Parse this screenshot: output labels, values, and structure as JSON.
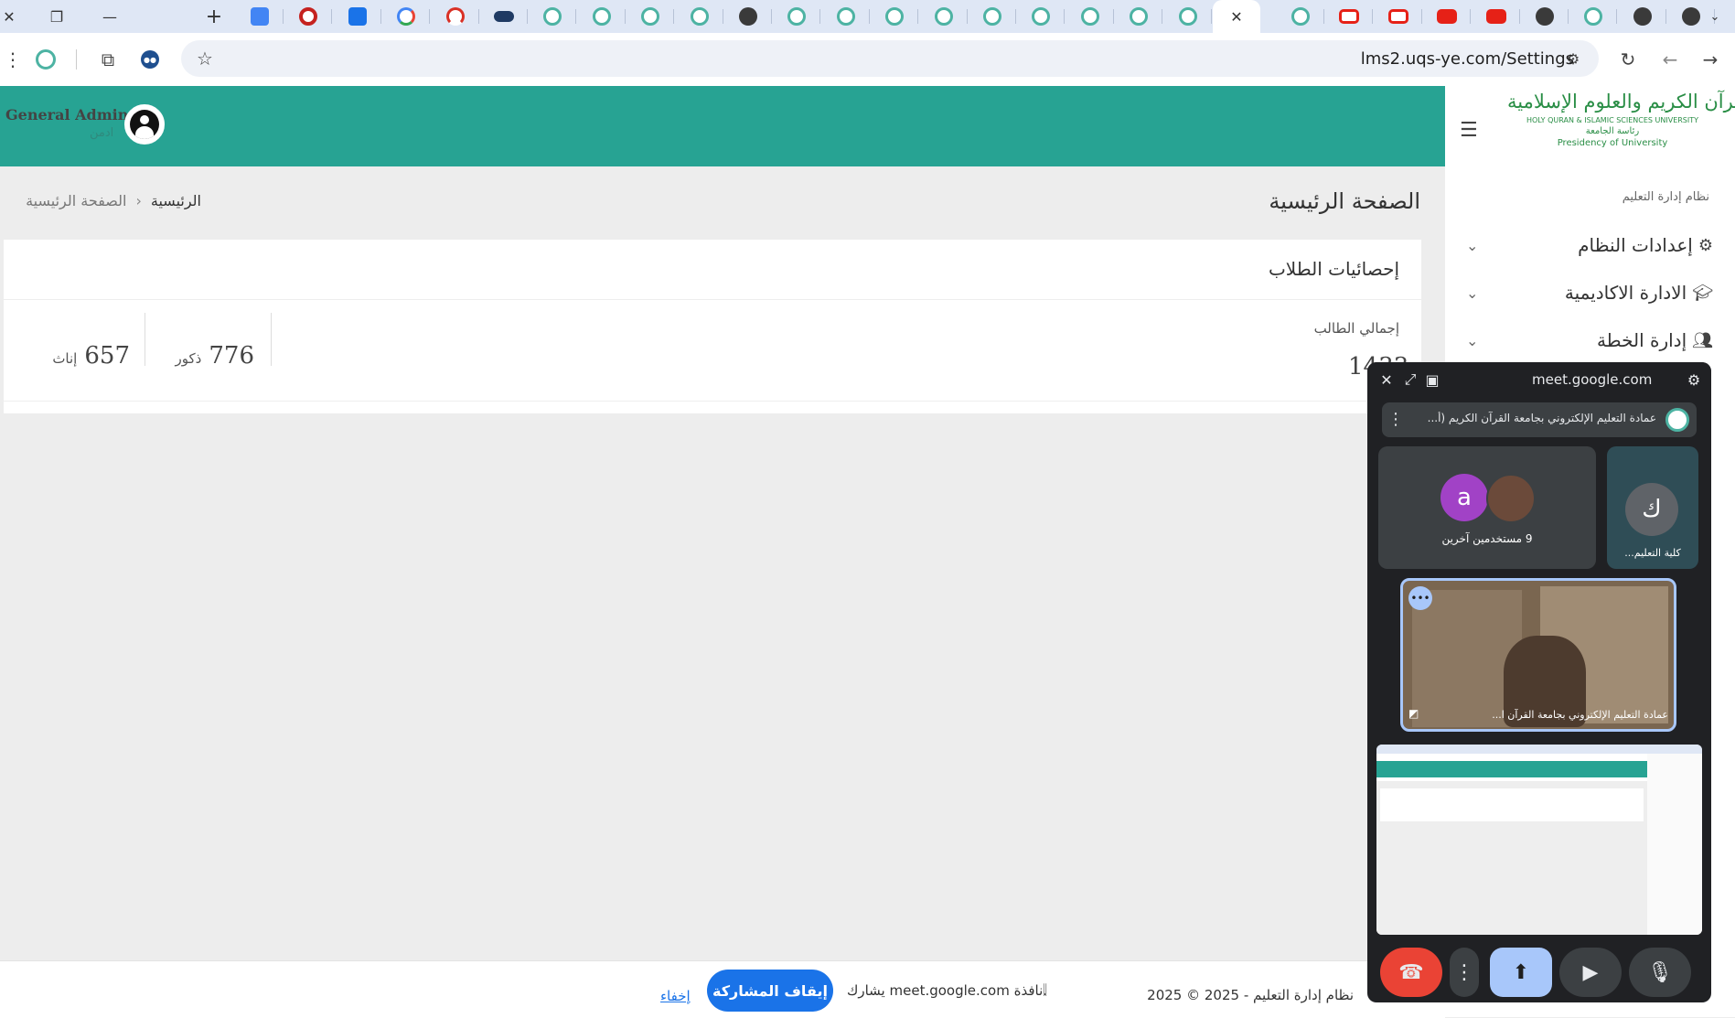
{
  "browser": {
    "url": "lms2.uqs-ye.com/Settings",
    "tabs": [
      {
        "icon": "translate-icon",
        "kind": "tr"
      },
      {
        "icon": "record-icon",
        "kind": "red"
      },
      {
        "icon": "download-icon",
        "kind": "blue"
      },
      {
        "icon": "google-icon",
        "kind": "goo"
      },
      {
        "icon": "gauge-icon",
        "kind": "gauge"
      },
      {
        "icon": "toggle-icon",
        "kind": "pill"
      },
      {
        "icon": "university-logo-icon",
        "kind": "uni"
      },
      {
        "icon": "university-logo-icon",
        "kind": "uni"
      },
      {
        "icon": "university-logo-icon",
        "kind": "uni"
      },
      {
        "icon": "university-logo-icon",
        "kind": "uni"
      },
      {
        "icon": "chrome-icon",
        "kind": "dark"
      },
      {
        "icon": "university-logo-icon",
        "kind": "uni"
      },
      {
        "icon": "university-logo-icon",
        "kind": "uni"
      },
      {
        "icon": "university-logo-icon",
        "kind": "uni"
      },
      {
        "icon": "university-logo-icon",
        "kind": "uni"
      },
      {
        "icon": "university-logo-icon",
        "kind": "uni"
      },
      {
        "icon": "university-logo-icon",
        "kind": "uni"
      },
      {
        "icon": "university-logo-icon",
        "kind": "uni"
      },
      {
        "icon": "university-logo-icon",
        "kind": "uni"
      },
      {
        "icon": "university-logo-icon",
        "kind": "uni"
      },
      {
        "icon": "university-logo-icon",
        "kind": "uni",
        "active": true
      },
      {
        "icon": "university-logo-icon",
        "kind": "uni"
      },
      {
        "icon": "youtube-icon",
        "kind": "ytr"
      },
      {
        "icon": "youtube-icon",
        "kind": "ytr"
      },
      {
        "icon": "youtube-icon",
        "kind": "yt"
      },
      {
        "icon": "youtube-icon",
        "kind": "yt"
      },
      {
        "icon": "openai-icon",
        "kind": "dark"
      },
      {
        "icon": "university-logo-icon",
        "kind": "uni"
      },
      {
        "icon": "tab-icon",
        "kind": "dark"
      },
      {
        "icon": "tab-icon",
        "kind": "dark"
      }
    ]
  },
  "header": {
    "user_name": "General Admin",
    "user_role": "ادمن"
  },
  "logo": {
    "arabic": "جامعة القرآن الكريم والعلوم الإسلامية",
    "english": "HOLY QURAN & ISLAMIC SCIENCES UNIVERSITY",
    "presidency_ar": "رئاسة الجامعة",
    "presidency_en": "Presidency of University"
  },
  "sidebar": {
    "section_title": "نظام إدارة التعليم",
    "items": [
      {
        "label": "إعدادات النظام",
        "icon": "gears-icon"
      },
      {
        "label": "الادارة الاكاديمية",
        "icon": "graduation-cap-icon"
      },
      {
        "label": "إدارة الخطة",
        "icon": "users-icon"
      }
    ]
  },
  "page": {
    "title": "الصفحة الرئيسية",
    "breadcrumb_home": "الرئيسية",
    "breadcrumb_current": "الصفحة الرئيسية",
    "breadcrumb_sep": "‹"
  },
  "stats": {
    "card_title": "إحصائيات الطلاب",
    "total_label": "إجمالي الطالب",
    "total_value": "1433",
    "male_value": "776",
    "male_label": "ذكور",
    "female_value": "657",
    "female_label": "إناث"
  },
  "footer": {
    "text": "نظام إدارة التعليم - 2025 © 2025"
  },
  "share_bar": {
    "message": "يشارك meet.google.com نافذة.",
    "stop_label": "إيقاف المشاركة",
    "hide_label": "إخفاء"
  },
  "meet": {
    "domain": "meet.google.com",
    "meeting_title": "عمادة التعليم الإلكتروني بجامعة القرآن الكريم (أ...",
    "tile_college_initial": "ك",
    "tile_college_name": "كلية التعليم...",
    "tile_others_initial": "a",
    "tile_others_label": "9 مستخدمين آخرين",
    "tile_presenter_name": "عمادة التعليم الإلكتروني بجامعة القرآن ا...",
    "colors": {
      "end_call": "#ea4335",
      "present": "#a8c7fa",
      "avatar_a": "#a142c6",
      "avatar_k": "#5f6368"
    }
  }
}
